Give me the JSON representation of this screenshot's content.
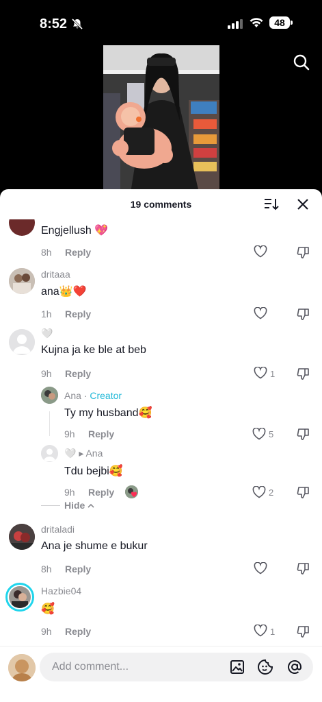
{
  "status_bar": {
    "time": "8:52",
    "battery": "48"
  },
  "sheet": {
    "comment_count": "19 comments"
  },
  "comments": [
    {
      "name": "",
      "text": "Engjellush 💖",
      "time": "8h",
      "reply": "Reply",
      "likes": ""
    },
    {
      "name": "dritaaa",
      "text": "ana👑❤️",
      "time": "1h",
      "reply": "Reply",
      "likes": ""
    },
    {
      "name": "🤍",
      "text": "Kujna ja ke ble at beb",
      "time": "9h",
      "reply": "Reply",
      "likes": "1"
    },
    {
      "name": "Ana · ",
      "badge": "Creator",
      "text": "Ty my husband🥰",
      "time": "9h",
      "reply": "Reply",
      "likes": "5"
    },
    {
      "name": "🤍 ▸ Ana",
      "text": "Tdu bejbi🥰",
      "time": "9h",
      "reply": "Reply",
      "likes": "2"
    },
    {
      "name": "dritaladi",
      "text": "Ana je shume e bukur",
      "time": "8h",
      "reply": "Reply",
      "likes": ""
    },
    {
      "name": "Hazbie04",
      "text": "🥰",
      "time": "9h",
      "reply": "Reply",
      "likes": "1"
    }
  ],
  "thread": {
    "hide_label": "Hide"
  },
  "composer": {
    "placeholder": "Add comment..."
  },
  "colors": {
    "creator": "#20b8d8",
    "like_heart": "#fe2c55",
    "story_ring": "#20d5ec"
  }
}
